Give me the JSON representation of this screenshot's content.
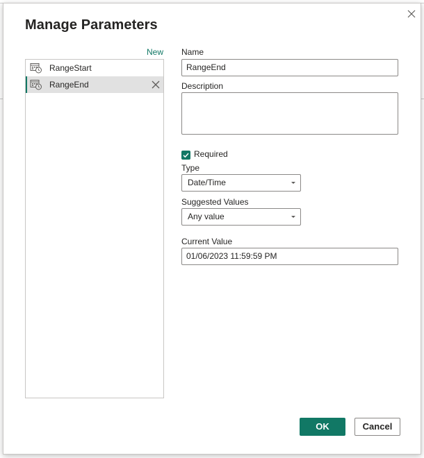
{
  "dialog": {
    "title": "Manage Parameters",
    "new_link": "New"
  },
  "parameters": [
    {
      "name": "RangeStart",
      "icon": "datetime-param-icon",
      "selected": false
    },
    {
      "name": "RangeEnd",
      "icon": "datetime-param-icon",
      "selected": true
    }
  ],
  "form": {
    "name_label": "Name",
    "name_value": "RangeEnd",
    "description_label": "Description",
    "description_value": "",
    "required_label": "Required",
    "required_checked": true,
    "type_label": "Type",
    "type_value": "Date/Time",
    "suggested_label": "Suggested Values",
    "suggested_value": "Any value",
    "current_label": "Current Value",
    "current_value": "01/06/2023 11:59:59 PM"
  },
  "buttons": {
    "ok": "OK",
    "cancel": "Cancel"
  },
  "colors": {
    "accent": "#117865",
    "selected_bg": "#e1e1e1",
    "border": "#8a8886"
  }
}
